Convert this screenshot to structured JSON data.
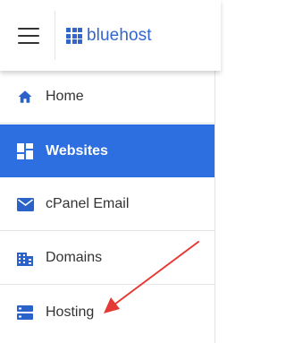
{
  "header": {
    "menu_icon": "hamburger-menu-icon",
    "logo_icon": "bluehost-grid-logo-icon",
    "logo_text": "bluehost"
  },
  "sidebar": {
    "items": [
      {
        "label": "Home",
        "icon": "home-icon",
        "active": false
      },
      {
        "label": "Websites",
        "icon": "websites-grid-icon",
        "active": true
      },
      {
        "label": "cPanel Email",
        "icon": "envelope-icon",
        "active": false
      },
      {
        "label": "Domains",
        "icon": "building-icon",
        "active": false
      },
      {
        "label": "Hosting",
        "icon": "server-icon",
        "active": false
      }
    ]
  },
  "annotation": {
    "arrow_icon": "red-arrow-pointer-icon",
    "target": "Hosting"
  },
  "colors": {
    "brand": "#3366cc",
    "active_bg": "#2d6ee0",
    "icon": "#2a62c9",
    "arrow": "#e53935",
    "text": "#333333"
  }
}
